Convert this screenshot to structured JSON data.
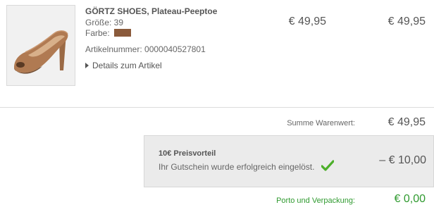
{
  "product": {
    "name": "GÖRTZ SHOES, Plateau-Peeptoe",
    "size": "Größe: 39",
    "color_label": "Farbe:",
    "color_swatch": "#8a5a3b",
    "article_number": "Artikelnummer: 0000040527801",
    "details_link": "Details zum Artikel",
    "unit_price": "€ 49,95",
    "total_price": "€ 49,95",
    "image_icon": "peeptoe-shoe-image"
  },
  "summary": {
    "goods_value_label": "Summe Warenwert:",
    "goods_value": "€ 49,95",
    "voucher": {
      "title": "10€ Preisvorteil",
      "message": "Ihr Gutschein wurde erfolgreich eingelöst.",
      "value": "– € 10,00",
      "icon": "checkmark-icon"
    },
    "shipping_label": "Porto und Verpackung:",
    "shipping_value": "€ 0,00"
  },
  "colors": {
    "success": "#2f9a2f",
    "check": "#4caf2a",
    "voucher_bg": "#ebebeb"
  }
}
